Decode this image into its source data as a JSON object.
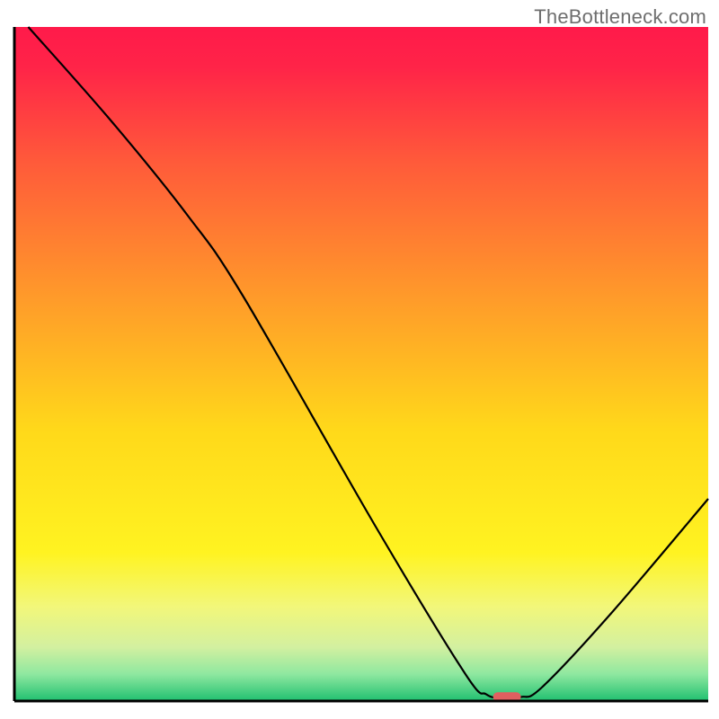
{
  "watermark": "TheBottleneck.com",
  "chart_data": {
    "type": "line",
    "title": "",
    "xlabel": "",
    "ylabel": "",
    "xlim": [
      0,
      100
    ],
    "ylim": [
      0,
      100
    ],
    "x": [
      2,
      25,
      67,
      70,
      74,
      100
    ],
    "values": [
      100,
      72,
      1,
      0.5,
      1,
      30
    ],
    "marker": {
      "x": 71,
      "y": 0.6,
      "w": 4,
      "h": 1.4,
      "color": "#e06060"
    },
    "gradient_stops": [
      {
        "offset": 0.0,
        "color": "#ff1a4a"
      },
      {
        "offset": 0.06,
        "color": "#ff2448"
      },
      {
        "offset": 0.2,
        "color": "#ff5a3a"
      },
      {
        "offset": 0.4,
        "color": "#ff9a2a"
      },
      {
        "offset": 0.6,
        "color": "#ffd91a"
      },
      {
        "offset": 0.78,
        "color": "#fff321"
      },
      {
        "offset": 0.86,
        "color": "#f2f77a"
      },
      {
        "offset": 0.92,
        "color": "#d3f0a0"
      },
      {
        "offset": 0.96,
        "color": "#8fe8a0"
      },
      {
        "offset": 1.0,
        "color": "#20c070"
      }
    ],
    "axis_color": "#000000"
  }
}
